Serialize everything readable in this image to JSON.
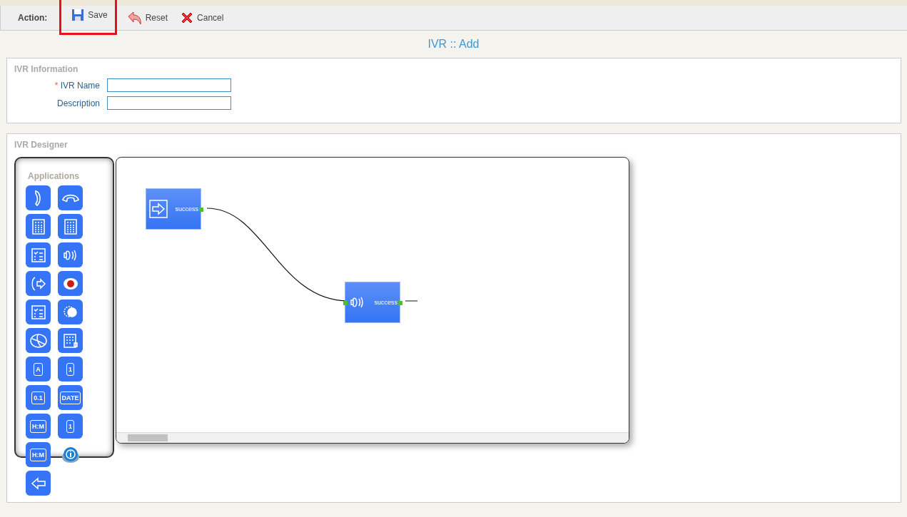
{
  "toolbar": {
    "label": "Action:",
    "actions": [
      {
        "kind": "save",
        "label": "Save",
        "highlighted": true
      },
      {
        "kind": "reset",
        "label": "Reset",
        "highlighted": false
      },
      {
        "kind": "cancel",
        "label": "Cancel",
        "highlighted": false
      }
    ]
  },
  "page_title": "IVR :: Add",
  "info_section": {
    "legend": "IVR Information",
    "fields": [
      {
        "label": "IVR Name",
        "required_mark": "*"
      },
      {
        "label": "Description"
      }
    ]
  },
  "designer": {
    "legend": "IVR Designer",
    "palette_title": "Applications",
    "palette": [
      {
        "kind": "answer"
      },
      {
        "kind": "hangup"
      },
      {
        "kind": "calc"
      },
      {
        "kind": "calc"
      },
      {
        "kind": "checklist"
      },
      {
        "kind": "speaker"
      },
      {
        "kind": "forward"
      },
      {
        "kind": "record"
      },
      {
        "kind": "checklist"
      },
      {
        "kind": "gear"
      },
      {
        "kind": "globe"
      },
      {
        "kind": "grid"
      },
      {
        "kind": "glyph",
        "glyph": "A"
      },
      {
        "kind": "glyph",
        "glyph": "1"
      },
      {
        "kind": "glyph",
        "glyph": "0.1"
      },
      {
        "kind": "glyph",
        "glyph": "DATE"
      },
      {
        "kind": "glyph",
        "glyph": "H:M"
      },
      {
        "kind": "glyph",
        "glyph": "1"
      },
      {
        "kind": "glyph",
        "glyph": "H:M"
      },
      {
        "kind": "info"
      },
      {
        "kind": "back"
      }
    ],
    "nodes": [
      {
        "kind": "start",
        "port_label": "success",
        "input": false
      },
      {
        "kind": "speaker",
        "port_label": "success",
        "input": true
      }
    ]
  }
}
